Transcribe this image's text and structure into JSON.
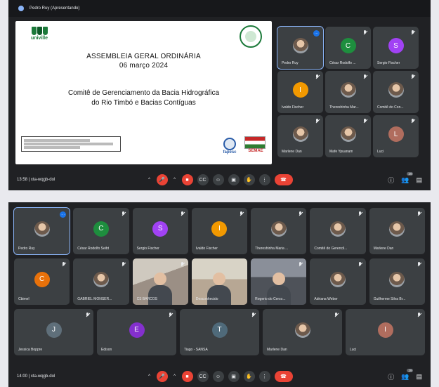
{
  "shot1": {
    "presenter_bar": "Pedro Ruy (Apresentando)",
    "slide": {
      "logo_left": "univille",
      "title_line1": "ASSEMBLEIA GERAL ORDINÁRIA",
      "title_line2": "06 março 2024",
      "subtitle_line1": "Comitê de Gerenciamento da Bacia Hidrográfica",
      "subtitle_line2": "do Rio Timbó e Bacias Contíguas",
      "logo_fapesc": "fapesc",
      "logo_semae": "SEMAE"
    },
    "participants": [
      {
        "name": "Pedro Ruy",
        "avatar_type": "photo",
        "active": true,
        "more_button": true
      },
      {
        "name": "César Rodolfo ...",
        "initial": "C",
        "color": "#1e8e3e",
        "mic_off": true
      },
      {
        "name": "Sergio Fischer",
        "initial": "S",
        "color": "#a142f4",
        "mic_off": true
      },
      {
        "name": "Ivaldo Fischer",
        "initial": "I",
        "color": "#f29900",
        "mic_off": true
      },
      {
        "name": "Thereshinha Mar...",
        "avatar_type": "photo",
        "mic_off": true
      },
      {
        "name": "Comitê do Con...",
        "avatar_type": "photo",
        "mic_off": true
      },
      {
        "name": "Marlene Dan",
        "avatar_type": "photo",
        "mic_off": true
      },
      {
        "name": "Mafe Ypuanam",
        "avatar_type": "photo",
        "mic_off": true
      },
      {
        "name": "Luci",
        "initial": "L",
        "color": "#b06d5e",
        "mic_off": true
      }
    ],
    "bottom": {
      "time": "13:58",
      "meeting_code": "xta-wqgb-dol"
    }
  },
  "shot2": {
    "row1": [
      {
        "name": "Pedro Ruy",
        "avatar_type": "photo",
        "active": true,
        "more_button": true
      },
      {
        "name": "César Rodolfo Seibt",
        "initial": "C",
        "color": "#1e8e3e",
        "mic_off": true
      },
      {
        "name": "Sergio Fischer",
        "initial": "S",
        "color": "#a142f4",
        "mic_off": true
      },
      {
        "name": "Ivaldo Fischer",
        "initial": "I",
        "color": "#f29900",
        "mic_off": true
      },
      {
        "name": "Thereshinha Maria ...",
        "avatar_type": "photo",
        "mic_off": true
      },
      {
        "name": "Comitê do Gerencil...",
        "avatar_type": "photo",
        "mic_off": true
      },
      {
        "name": "Marlene Dan",
        "avatar_type": "photo",
        "mic_off": true
      }
    ],
    "row2": [
      {
        "name": "Cbimel",
        "initial": "C",
        "color": "#e8710a",
        "mic_off": true
      },
      {
        "name": "GABRIEL MONSER...",
        "avatar_type": "photo",
        "mic_off": true
      },
      {
        "name": "CS BARCOS",
        "video": "v1",
        "mic_off": true
      },
      {
        "name": "Desconhecido",
        "video": "v2",
        "mic_off": false
      },
      {
        "name": "Rogerio do Cerco...",
        "video": "v3",
        "mic_off": true
      },
      {
        "name": "Adriana Weber",
        "avatar_type": "photo",
        "mic_off": true
      },
      {
        "name": "Guilherme Silva Br...",
        "avatar_type": "photo",
        "mic_off": true
      }
    ],
    "row3": [
      {
        "name": "Jessica Boppre",
        "initial": "J",
        "color": "#5f6f7a",
        "mic_off": true
      },
      {
        "name": "Edison",
        "initial": "E",
        "color": "#8430ce",
        "mic_off": true
      },
      {
        "name": "Tiago - SANSA",
        "initial": "T",
        "color": "#4f6a7a",
        "mic_off": true
      },
      {
        "name": "Marlene Dan",
        "avatar_type": "photo",
        "mic_off": true
      },
      {
        "name": "Luci",
        "initial": "I",
        "color": "#b06d5e",
        "mic_off": true
      }
    ],
    "bottom": {
      "time": "14:00",
      "meeting_code": "xta-wqgb-dol"
    }
  },
  "controls": {
    "caret": "^",
    "mic": "🎤",
    "camera": "■",
    "captions": "CC",
    "emoji": "☺",
    "present": "▣",
    "raise_hand": "✋",
    "more": "⋮",
    "hang_up": "☎",
    "info": "ⓘ",
    "people": "👥",
    "people_count": "29",
    "chat": "▤"
  }
}
